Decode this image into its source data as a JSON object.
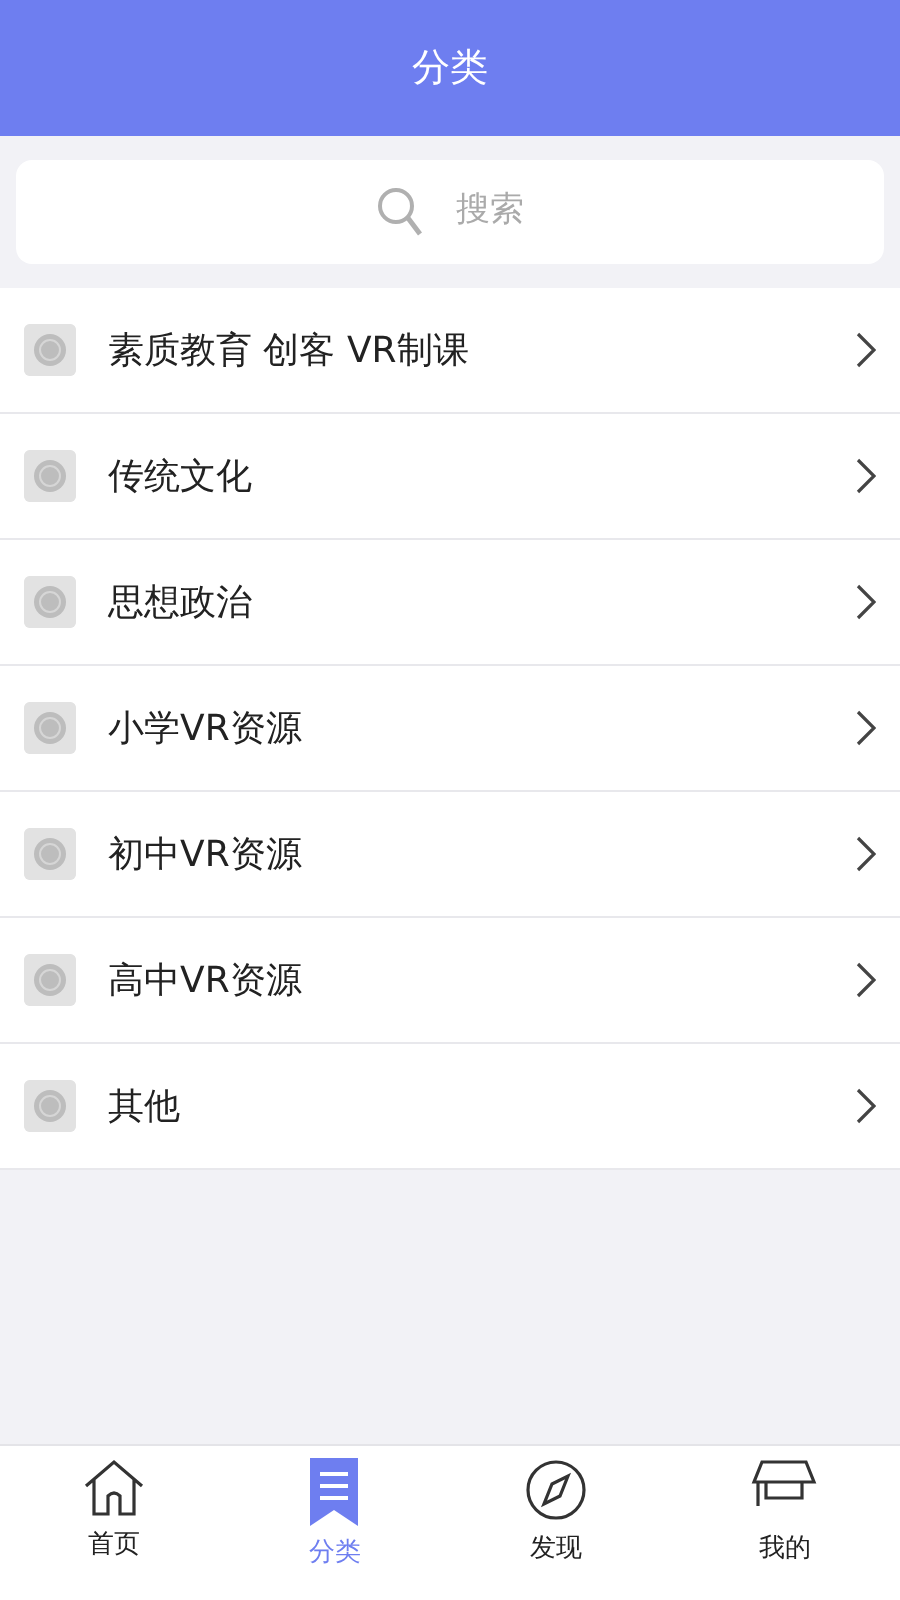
{
  "header": {
    "title": "分类"
  },
  "search": {
    "placeholder": "搜索"
  },
  "categories": [
    {
      "label": "素质教育 创客 VR制课"
    },
    {
      "label": "传统文化"
    },
    {
      "label": "思想政治"
    },
    {
      "label": "小学VR资源"
    },
    {
      "label": "初中VR资源"
    },
    {
      "label": "高中VR资源"
    },
    {
      "label": "其他"
    }
  ],
  "tabs": [
    {
      "label": "首页",
      "kind": "home",
      "selected": false
    },
    {
      "label": "分类",
      "kind": "category",
      "selected": true
    },
    {
      "label": "发现",
      "kind": "discover",
      "selected": false
    },
    {
      "label": "我的",
      "kind": "mine",
      "selected": false
    }
  ]
}
